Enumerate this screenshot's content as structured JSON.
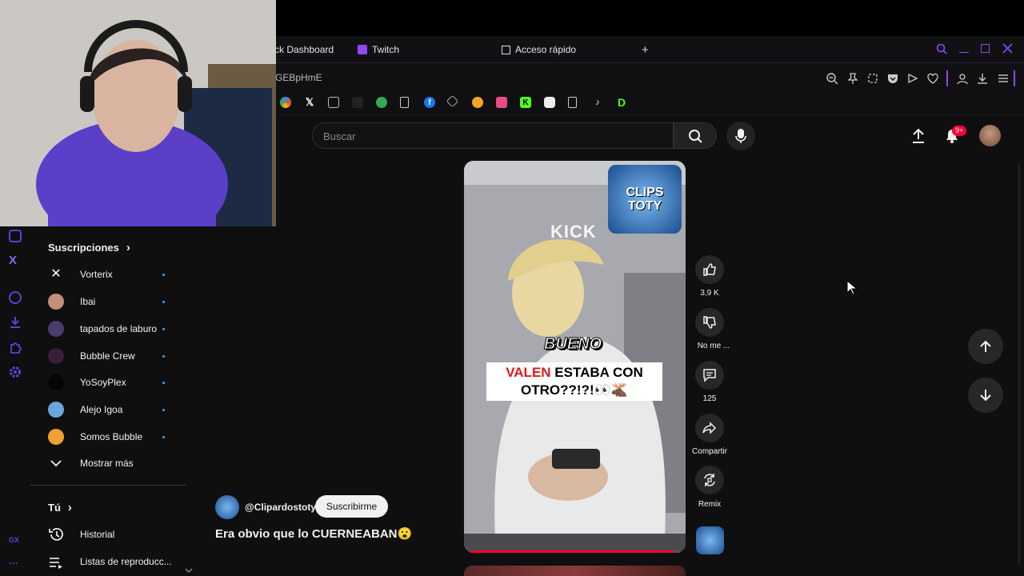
{
  "browser": {
    "tabs": [
      {
        "label": "ck Dashboard"
      },
      {
        "label": "Twitch"
      },
      {
        "label": "Acceso rápido"
      }
    ],
    "url_fragment": "GEBpHmE"
  },
  "youtube": {
    "search": {
      "placeholder": "Buscar"
    },
    "notifications_badge": "9+"
  },
  "sidebar": {
    "subscriptions_title": "Suscripciones",
    "subscriptions": [
      {
        "name": "Vorterix",
        "color": "#ffffff"
      },
      {
        "name": "Ibai",
        "color": "#c48f7a"
      },
      {
        "name": "tapados de laburo",
        "color": "#4a3a6e"
      },
      {
        "name": "Bubble Crew",
        "color": "#6a2f6a"
      },
      {
        "name": "YoSoyPlex",
        "color": "#050505"
      },
      {
        "name": "Alejo Igoa",
        "color": "#6aa6e0"
      },
      {
        "name": "Somos Bubble",
        "color": "#f0a030"
      }
    ],
    "show_more": "Mostrar más",
    "you_title": "Tú",
    "you_items": [
      {
        "label": "Historial"
      },
      {
        "label": "Listas de reproducc..."
      }
    ]
  },
  "short": {
    "watermark": "KICK",
    "caption_line1": "BUENO",
    "caption_highlight": "VALEN",
    "caption_rest1": " ESTABA CON",
    "caption_line3": "OTRO??!?!👀🫎",
    "channel_handle": "@Clipardostoty",
    "subscribe_label": "Suscribirme",
    "title": "Era obvio que lo CUERNEABAN😮",
    "logo_text": "CLIPS TOTY",
    "actions": {
      "likes": "3,9 K",
      "dislike": "No me ...",
      "comments": "125",
      "share": "Compartir",
      "remix": "Remix"
    },
    "progress": 0.97
  },
  "colors": {
    "accent": "#3ea6ff",
    "brand_red": "#ff0033",
    "browser_purple": "#9146ff"
  }
}
